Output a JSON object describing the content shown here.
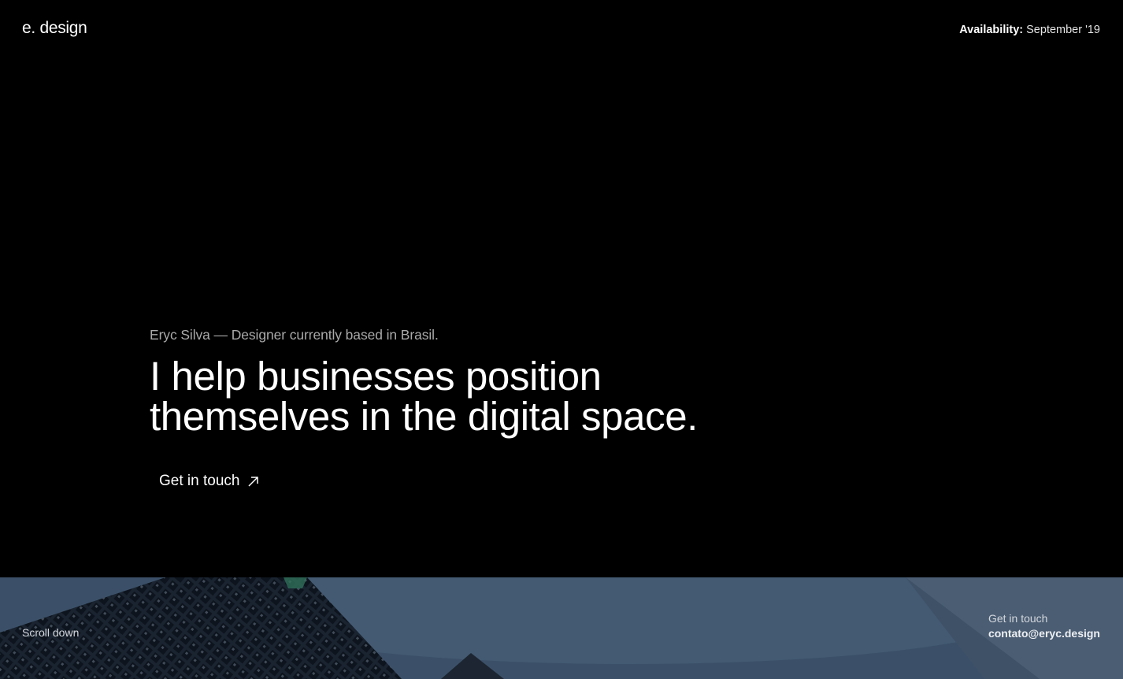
{
  "header": {
    "logo": "e. design",
    "availability_label": "Availability:",
    "availability_value": "September '19"
  },
  "hero": {
    "intro": "Eryc Silva — Designer currently based in Brasil.",
    "headline_line1": "I help businesses position",
    "headline_line2": "themselves in the digital space.",
    "cta_label": "Get in touch",
    "cta_icon": "arrow-up-right-icon"
  },
  "footer_bar": {
    "scroll_label": "Scroll down",
    "contact_label": "Get in touch",
    "contact_email": "contato@eryc.design"
  },
  "colors": {
    "background": "#000000",
    "text": "#ffffff",
    "muted_text": "#a9a9a9",
    "photo_tint": "#34485e"
  }
}
